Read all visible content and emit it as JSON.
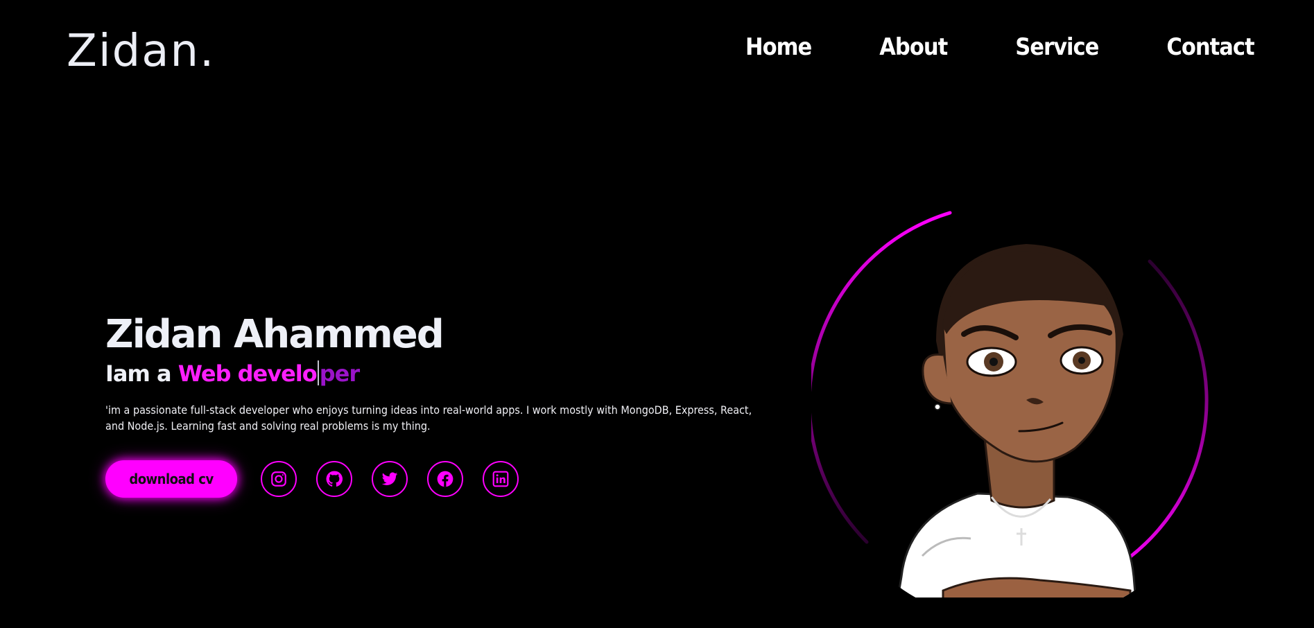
{
  "logo": "Zidan.",
  "nav": {
    "home": "Home",
    "about": "About",
    "service": "Service",
    "contact": "Contact"
  },
  "hero": {
    "name": "Zidan Ahammed",
    "role_prefix": "Iam a ",
    "role_typed": "Web develo",
    "role_rest": "per",
    "bio": "'im a passionate full-stack developer who enjoys turning ideas into real-world apps. I work mostly with MongoDB, Express, React, and Node.js. Learning fast and solving real problems is my thing.",
    "cv_button": "download cv"
  },
  "socials": [
    {
      "icon": "instagram-icon"
    },
    {
      "icon": "github-icon"
    },
    {
      "icon": "twitter-icon"
    },
    {
      "icon": "facebook-icon"
    },
    {
      "icon": "linkedin-icon"
    }
  ],
  "colors": {
    "background": "#000000",
    "accent": "#ff00ff",
    "text": "#f2f2f7"
  }
}
